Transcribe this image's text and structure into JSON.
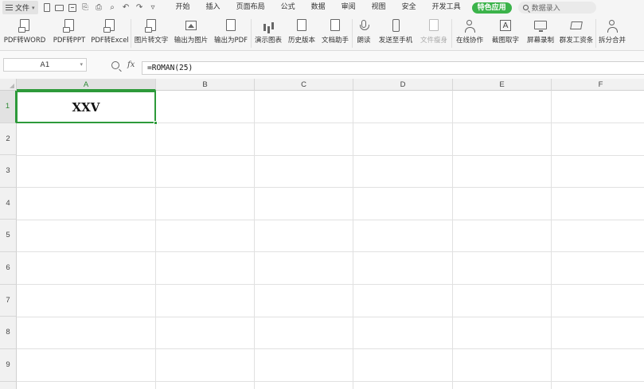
{
  "menubar": {
    "file_label": "文件",
    "tabs": [
      "开始",
      "插入",
      "页面布局",
      "公式",
      "数据",
      "审阅",
      "视图",
      "安全",
      "开发工具"
    ],
    "special_tab": "特色应用",
    "search_placeholder": "数据录入"
  },
  "ribbon": {
    "buttons": [
      {
        "label": "PDF转WORD",
        "icon": "pdf-to-word-icon"
      },
      {
        "label": "PDF转PPT",
        "icon": "pdf-to-ppt-icon"
      },
      {
        "label": "PDF转Excel",
        "icon": "pdf-to-excel-icon"
      },
      {
        "label": "图片转文字",
        "icon": "image-to-text-icon"
      },
      {
        "label": "输出为图片",
        "icon": "export-image-icon"
      },
      {
        "label": "输出为PDF",
        "icon": "export-pdf-icon"
      },
      {
        "label": "演示图表",
        "icon": "chart-icon"
      },
      {
        "label": "历史版本",
        "icon": "history-icon"
      },
      {
        "label": "文档助手",
        "icon": "doc-assistant-icon"
      },
      {
        "label": "朗读",
        "icon": "read-aloud-icon"
      },
      {
        "label": "发送至手机",
        "icon": "send-to-phone-icon"
      },
      {
        "label": "文件瘦身",
        "icon": "file-slim-icon",
        "disabled": true
      },
      {
        "label": "在线协作",
        "icon": "collaborate-icon"
      },
      {
        "label": "截图取字",
        "icon": "screenshot-ocr-icon"
      },
      {
        "label": "屏幕录制",
        "icon": "screen-record-icon"
      },
      {
        "label": "群发工资条",
        "icon": "payslip-icon"
      },
      {
        "label": "拆分合并",
        "icon": "split-merge-icon"
      }
    ]
  },
  "formula_bar": {
    "cell_ref": "A1",
    "fx_label": "fx",
    "formula": "=ROMAN(25)"
  },
  "sheet": {
    "columns": [
      "A",
      "B",
      "C",
      "D",
      "E",
      "F"
    ],
    "rows": [
      "1",
      "2",
      "3",
      "4",
      "5",
      "6",
      "7",
      "8",
      "9"
    ],
    "active_cell": "A1",
    "cells": {
      "A1": "XXV"
    },
    "accent_color": "#2d9a3a"
  }
}
